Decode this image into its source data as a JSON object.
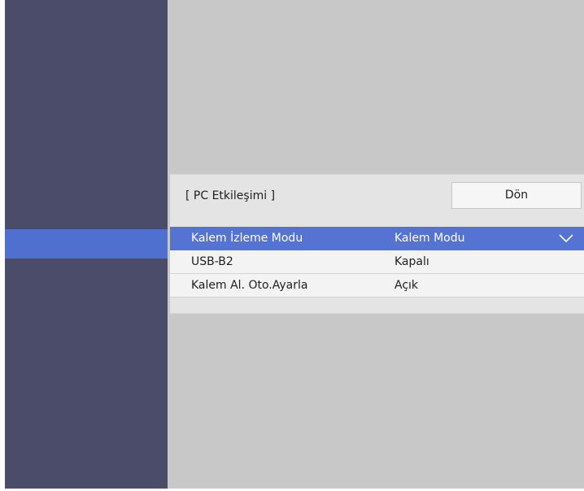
{
  "panel": {
    "title": "[ PC Etkileşimi ]",
    "back_label": "Dön"
  },
  "menu": {
    "items": [
      {
        "label": "Kalem İzleme Modu",
        "value": "Kalem Modu",
        "selected": true,
        "icon": "chevron-down-icon"
      },
      {
        "label": "USB-B2",
        "value": "Kapalı",
        "selected": false
      },
      {
        "label": "Kalem Al. Oto.Ayarla",
        "value": "Açık",
        "selected": false
      }
    ]
  },
  "colors": {
    "sidebar": "#4a4c6a",
    "highlight": "#5473d2",
    "main_background": "#c8c8c8",
    "panel_background": "#e4e4e4",
    "row_background": "#f3f3f3"
  }
}
